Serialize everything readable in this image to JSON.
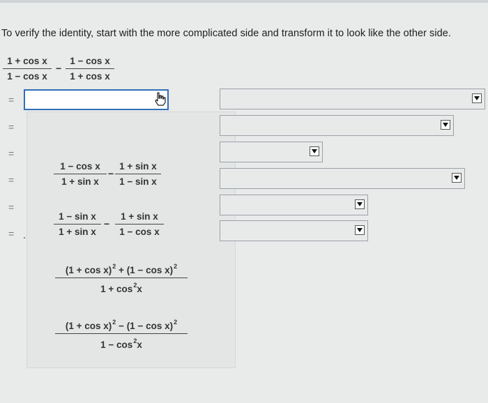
{
  "instruction": "To verify the identity, start with the more complicated side and transform it to look like the other side.",
  "identity": {
    "term1": {
      "num": "1 + cos x",
      "den": "1 − cos x"
    },
    "operator": "−",
    "term2": {
      "num": "1 − cos x",
      "den": "1 + cos x"
    }
  },
  "equals": [
    "=",
    "=",
    "=",
    "=",
    "=",
    "="
  ],
  "options": [
    {
      "kind": "pair",
      "t1": {
        "num": "1 − cos x",
        "den": "1 + sin x"
      },
      "op": "−",
      "t2": {
        "num": "1 + sin x",
        "den": "1 − sin x"
      }
    },
    {
      "kind": "pair",
      "t1": {
        "num": "1 − sin x",
        "den": "1 + sin x"
      },
      "op": "−",
      "t2": {
        "num": "1 + sin x",
        "den": "1 − cos x"
      }
    },
    {
      "kind": "single",
      "num_a": "(1 + cos x)",
      "num_op": " + ",
      "num_b": "(1 − cos x)",
      "sup": "2",
      "den_a": "1 + cos",
      "den_sup": "2",
      "den_b": "x"
    },
    {
      "kind": "single",
      "num_a": "(1 + cos x)",
      "num_op": " − ",
      "num_b": "(1 − cos x)",
      "sup": "2",
      "den_a": "1 − cos",
      "den_sup": "2",
      "den_b": "x"
    }
  ],
  "selects": [
    "",
    "",
    "",
    "",
    "",
    ""
  ],
  "icons": {
    "cursor": "hand-pointer-icon",
    "dropdown": "triangle-down-icon"
  }
}
